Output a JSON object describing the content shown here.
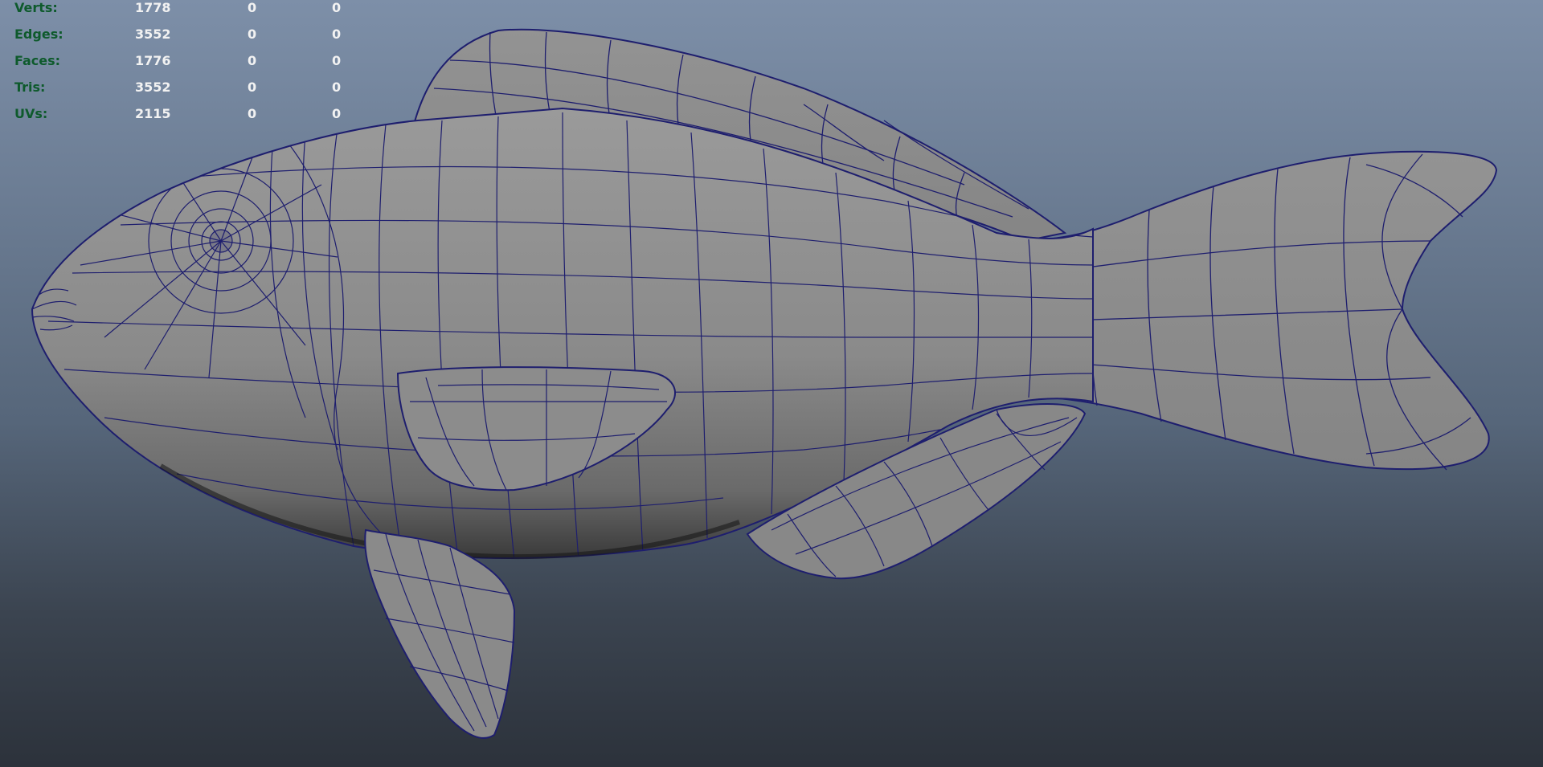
{
  "heads_up_display": {
    "rows": [
      {
        "label": "Verts:",
        "total": "1778",
        "selected": "0",
        "selected_uv": "0"
      },
      {
        "label": "Edges:",
        "total": "3552",
        "selected": "0",
        "selected_uv": "0"
      },
      {
        "label": "Faces:",
        "total": "1776",
        "selected": "0",
        "selected_uv": "0"
      },
      {
        "label": "Tris:",
        "total": "3552",
        "selected": "0",
        "selected_uv": "0"
      },
      {
        "label": "UVs:",
        "total": "2115",
        "selected": "0",
        "selected_uv": "0"
      }
    ]
  },
  "colors": {
    "viewport_top": "#7d8fa8",
    "viewport_bottom": "#2c323b",
    "mesh_fill": "#8a8a8a",
    "wireframe": "#1e1e6e",
    "hud_label": "#0e5a2c",
    "hud_value": "#f2f2f2"
  }
}
